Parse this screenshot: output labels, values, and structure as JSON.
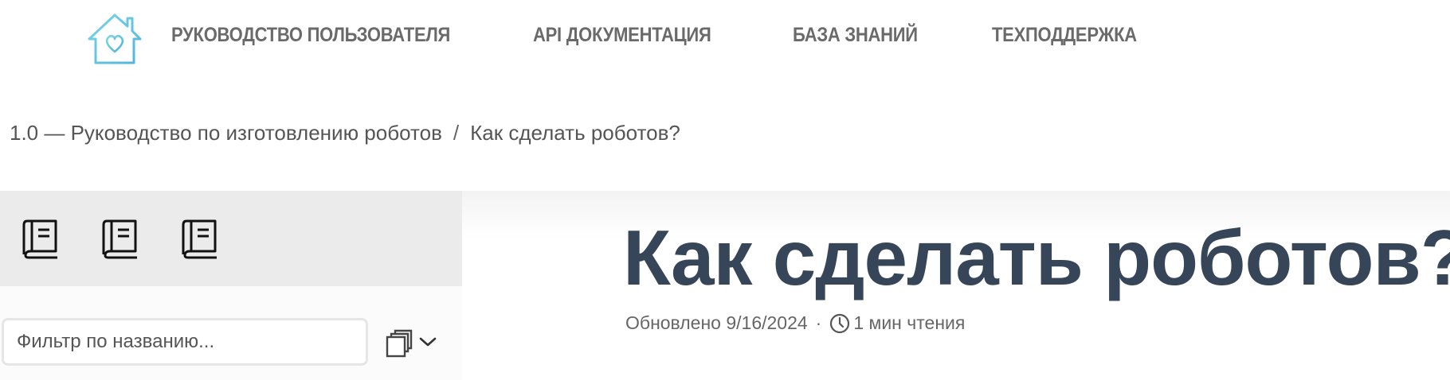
{
  "header": {
    "nav": [
      {
        "label": "РУКОВОДСТВО ПОЛЬЗОВАТЕЛЯ"
      },
      {
        "label": "API ДОКУМЕНТАЦИЯ"
      },
      {
        "label": "БАЗА ЗНАНИЙ"
      },
      {
        "label": "ТЕХПОДДЕРЖКА"
      }
    ],
    "logo_icon": "house-heart-icon",
    "logo_colors": [
      "#6fd0e4",
      "#5ab8e0"
    ]
  },
  "breadcrumb": {
    "items": [
      {
        "label": "1.0 — Руководство по изготовлению роботов"
      },
      {
        "label": "Как сделать роботов?"
      }
    ],
    "separator": "/"
  },
  "sidebar": {
    "book_icons": [
      "book-icon",
      "book-icon",
      "book-icon"
    ],
    "filter": {
      "value": "",
      "placeholder": "Фильтр по названию..."
    },
    "copy_icon": "copy-icon",
    "chevron_icon": "chevron-down-icon"
  },
  "article": {
    "title": "Как сделать роботов?",
    "updated": "Обновлено 9/16/2024",
    "separator": "·",
    "read_time": "1 мин чтения",
    "clock_icon": "clock-icon",
    "title_color": "#364658"
  }
}
